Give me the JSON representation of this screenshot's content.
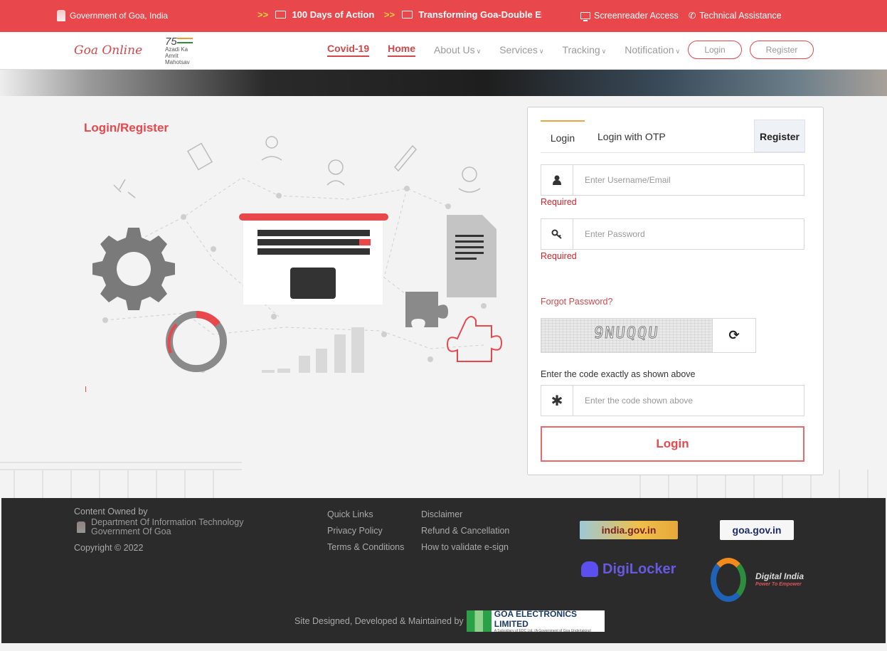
{
  "topbar": {
    "gov_label": "Government of Goa, India",
    "ticker": [
      "100 Days of Action",
      "Transforming Goa-Double Eng"
    ],
    "screenreader": "Screenreader Access",
    "technical": "Technical Assistance"
  },
  "nav": {
    "brand": "Goa Online",
    "azadi_line1": "Azadi Ka",
    "azadi_line2": "Amrit Mahotsav",
    "items": [
      {
        "label": "Covid-19",
        "active": true
      },
      {
        "label": "Home",
        "active": true
      },
      {
        "label": "About Us",
        "dropdown": true
      },
      {
        "label": "Services",
        "dropdown": true
      },
      {
        "label": "Tracking",
        "dropdown": true
      },
      {
        "label": "Notification",
        "dropdown": true
      }
    ],
    "login": "Login",
    "register": "Register"
  },
  "page": {
    "heading": "Login/Register"
  },
  "form": {
    "tabs": {
      "login": "Login",
      "otp": "Login with OTP",
      "register": "Register"
    },
    "username_placeholder": "Enter Username/Email",
    "password_placeholder": "Enter Password",
    "required": "Required",
    "forgot": "Forgot Password?",
    "captcha_text": "9NUQQU",
    "captcha_hint": "Enter the code exactly as shown above",
    "code_placeholder": "Enter the code shown above",
    "submit": "Login"
  },
  "footer": {
    "owned": "Content Owned by",
    "dept_line1": "Department Of Information Technology",
    "dept_line2": "Government Of Goa",
    "copyright": "Copyright © 2022",
    "links_col1": [
      "Quick Links",
      "Privacy Policy",
      "Terms & Conditions"
    ],
    "links_col2": [
      "Disclaimer",
      "Refund & Cancellation",
      "How to validate e-sign"
    ],
    "badge_india": "india.gov.in",
    "badge_goa": "goa.gov.in",
    "badge_digilocker": "DigiLocker",
    "badge_digital_india": "Digital India",
    "badge_digital_india_sub": "Power To Empower",
    "maintained": "Site Designed, Developed & Maintained by",
    "gel": "GOA ELECTRONICS LIMITED",
    "gel_sub": "A Subsidiary of EDC Ltd. (A Government of Goa Undertaking)"
  },
  "colors": {
    "accent": "#e8474c",
    "footer": "#2b2b2b",
    "tab_underline": "#e9a640"
  }
}
